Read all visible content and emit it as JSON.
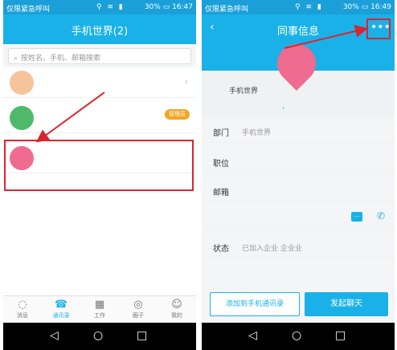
{
  "status_bar": {
    "carrier": "仅限紧急呼叫",
    "battery": "30%",
    "time_left": "16:47",
    "time_right": "16:49"
  },
  "left": {
    "header_title": "手机世界(2)",
    "search_placeholder": "按姓名、手机、邮箱搜索",
    "rows": [
      {
        "name": "",
        "badge": ""
      },
      {
        "name": "",
        "badge": "管理员"
      },
      {
        "name": "",
        "badge": ""
      }
    ],
    "tabs": [
      {
        "label": "消息",
        "icon": "chat-icon"
      },
      {
        "label": "通讯录",
        "icon": "contacts-icon"
      },
      {
        "label": "工作",
        "icon": "grid-icon"
      },
      {
        "label": "圈子",
        "icon": "circle-icon"
      },
      {
        "label": "我的",
        "icon": "user-icon"
      }
    ]
  },
  "right": {
    "header_title": "同事信息",
    "company": "手机世界",
    "info": [
      {
        "label": "部门",
        "value": "手机世界"
      },
      {
        "label": "职位",
        "value": ""
      },
      {
        "label": "邮箱",
        "value": ""
      },
      {
        "label": "",
        "value": ""
      },
      {
        "label": "状态",
        "value": "已加入企业   企业业"
      }
    ],
    "btn_add": "添加到手机通讯录",
    "btn_chat": "发起聊天"
  },
  "colors": {
    "accent": "#1ab1e8",
    "highlight": "#d8262f",
    "badge": "#f5a623"
  }
}
